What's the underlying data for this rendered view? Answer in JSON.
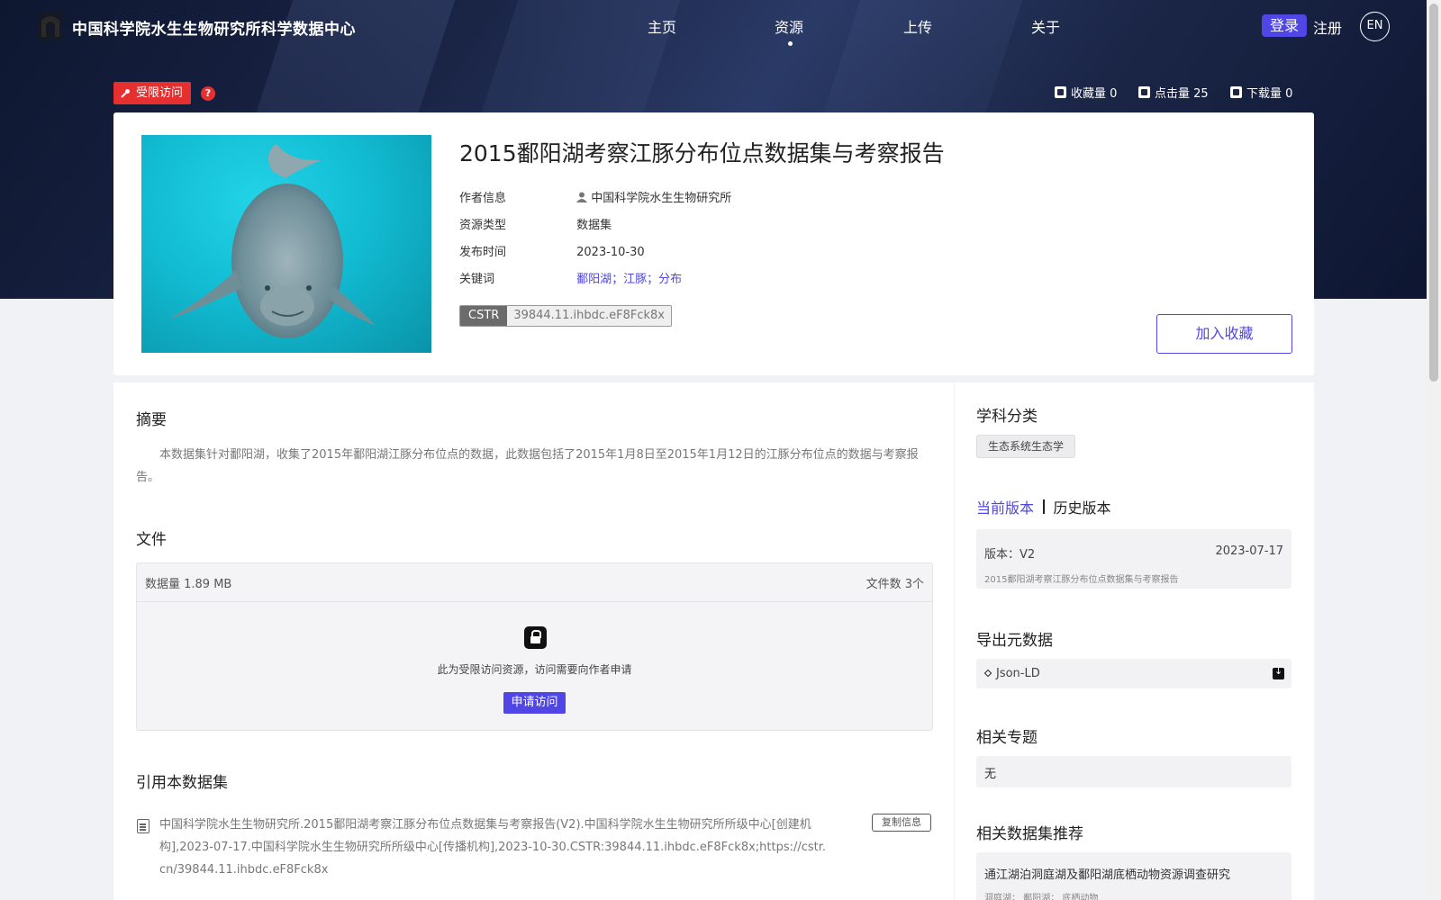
{
  "header": {
    "site_title": "中国科学院水生生物研究所科学数据中心",
    "nav": [
      {
        "label": "主页",
        "active": false
      },
      {
        "label": "资源",
        "active": true
      },
      {
        "label": "上传",
        "active": false
      },
      {
        "label": "关于",
        "active": false
      }
    ],
    "login_label": "登录",
    "register_label": "注册",
    "lang_label": "EN"
  },
  "badge": {
    "restricted_label": "受限访问",
    "help_label": "?"
  },
  "stats": {
    "favorites": "收藏量 0",
    "clicks": "点击量 25",
    "downloads": "下载量 0"
  },
  "dataset": {
    "title": "2015鄱阳湖考察江豚分布位点数据集与考察报告",
    "meta": [
      {
        "label": "作者信息",
        "value": "中国科学院水生生物研究所"
      },
      {
        "label": "资源类型",
        "value": "数据集"
      },
      {
        "label": "发布时间",
        "value": "2023-10-30"
      },
      {
        "label": "关键词",
        "value": "鄱阳湖；江豚；分布"
      }
    ],
    "cstr_key": "CSTR",
    "cstr_value": "39844.11.ihbdc.eF8Fck8x",
    "favorite_button": "加入收藏"
  },
  "abstract": {
    "heading": "摘要",
    "text": "本数据集针对鄱阳湖，收集了2015年鄱阳湖江豚分布位点的数据，此数据包括了2015年1月8日至2015年1月12日的江豚分布位点的数据与考察报告。"
  },
  "files": {
    "heading": "文件",
    "size": "数据量 1.89 MB",
    "count": "文件数 3个",
    "restricted_note": "此为受限访问资源，访问需要向作者申请",
    "apply_button": "申请访问"
  },
  "citation": {
    "heading": "引用本数据集",
    "text": "中国科学院水生生物研究所.2015鄱阳湖考察江豚分布位点数据集与考察报告(V2).中国科学院水生生物研究所所级中心[创建机构],2023-07-17.中国科学院水生生物研究所所级中心[传播机构],2023-10-30.CSTR:39844.11.ihbdc.eF8Fck8x;https://cstr.cn/39844.11.ihbdc.eF8Fck8x",
    "copy_button": "复制信息"
  },
  "sidebar": {
    "subject_heading": "学科分类",
    "subject_tag": "生态系统生态学",
    "version_current": "当前版本",
    "version_history": "历史版本",
    "version_label": "版本：V2",
    "version_date": "2023-07-17",
    "version_sub": "2015鄱阳湖考察江豚分布位点数据集与考察报告",
    "export_heading": "导出元数据",
    "export_format": "Json-LD",
    "topics_heading": "相关专题",
    "topics_value": "无",
    "recommend_heading": "相关数据集推荐",
    "recommend_title": "通江湖泊洞庭湖及鄱阳湖底栖动物资源调查研究",
    "recommend_tags": "洞庭湖； 鄱阳湖； 底栖动物"
  },
  "colors": {
    "accent": "#4f46e5",
    "restricted": "#e63030",
    "header_bg": "#1a2546"
  },
  "icons": [
    "logo-icon",
    "key-icon",
    "help-icon",
    "bookmark-icon",
    "eye-icon",
    "download-icon",
    "user-icon",
    "lock-icon",
    "citation-icon",
    "diamond-icon"
  ]
}
